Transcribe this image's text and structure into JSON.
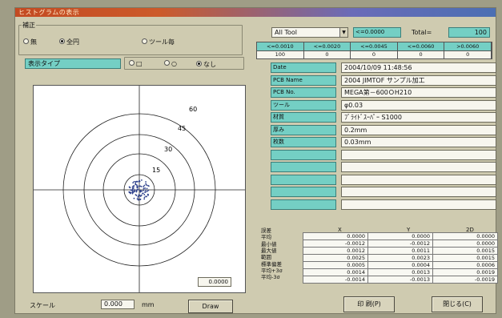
{
  "window": {
    "title": "ヒストグラムの表示"
  },
  "correction": {
    "label": "補正",
    "options": [
      {
        "label": "無",
        "selected": false
      },
      {
        "label": "全円",
        "selected": true
      },
      {
        "label": "ツール毎",
        "selected": false
      }
    ]
  },
  "display_type": {
    "header": "表示タイプ",
    "options": [
      {
        "label": "□",
        "selected": false
      },
      {
        "label": "○",
        "selected": false
      },
      {
        "label": "なし",
        "selected": true
      }
    ]
  },
  "plot": {
    "ring_labels": [
      "15",
      "30",
      "45",
      "60"
    ],
    "scale_box_value": "0.0000"
  },
  "scale": {
    "label": "スケール",
    "value": "0.000",
    "unit": "mm",
    "draw_button": "Draw"
  },
  "filter": {
    "tool_select": "All Tool",
    "top_value": "<=0.0000",
    "total_label": "Total=",
    "total_value": "100"
  },
  "range_table": {
    "headers": [
      "<=0.0010",
      "<=0.0020",
      "<=0.0045",
      "<=0.0060",
      ">0.0060"
    ],
    "values": [
      "100",
      "0",
      "0",
      "0",
      "0"
    ]
  },
  "info": [
    {
      "label": "Date",
      "value": "2004/10/09 11:48:56"
    },
    {
      "label": "PCB Name",
      "value": "2004 JIMTOF サンプル加工"
    },
    {
      "label": "PCB No.",
      "value": "MEGA第－600ＯH210"
    },
    {
      "label": "ツール",
      "value": "φ0.03"
    },
    {
      "label": "材質",
      "value": "ﾌﾞﾗｲﾄﾞｽｰﾊﾟｰ S1000"
    },
    {
      "label": "厚み",
      "value": "0.2mm"
    },
    {
      "label": "枚数",
      "value": "0.03mm"
    },
    {
      "label": "",
      "value": ""
    },
    {
      "label": "",
      "value": ""
    },
    {
      "label": "",
      "value": ""
    },
    {
      "label": "",
      "value": ""
    },
    {
      "label": "",
      "value": ""
    }
  ],
  "stats": {
    "headers": [
      "X",
      "Y",
      "2D"
    ],
    "row_labels": [
      "誤差",
      "平均",
      "最小値",
      "最大値",
      "範囲",
      "標準偏差",
      "平均+3σ",
      "平均-3σ"
    ],
    "rows": [
      [
        "0.0000",
        "0.0000",
        "0.0000"
      ],
      [
        "-0.0012",
        "-0.0012",
        "0.0000"
      ],
      [
        "0.0012",
        "0.0011",
        "0.0015"
      ],
      [
        "0.0025",
        "0.0023",
        "0.0015"
      ],
      [
        "0.0005",
        "0.0004",
        "0.0006"
      ],
      [
        "0.0014",
        "0.0013",
        "0.0019"
      ],
      [
        "-0.0014",
        "-0.0013",
        "-0.0019"
      ]
    ]
  },
  "buttons": {
    "print": "印 刷(P)",
    "close": "閉じる(C)"
  },
  "colors": {
    "accent_cyan": "#74cfc4",
    "panel": "#cfcbb0",
    "plot_dots": "#2c3f8c"
  }
}
